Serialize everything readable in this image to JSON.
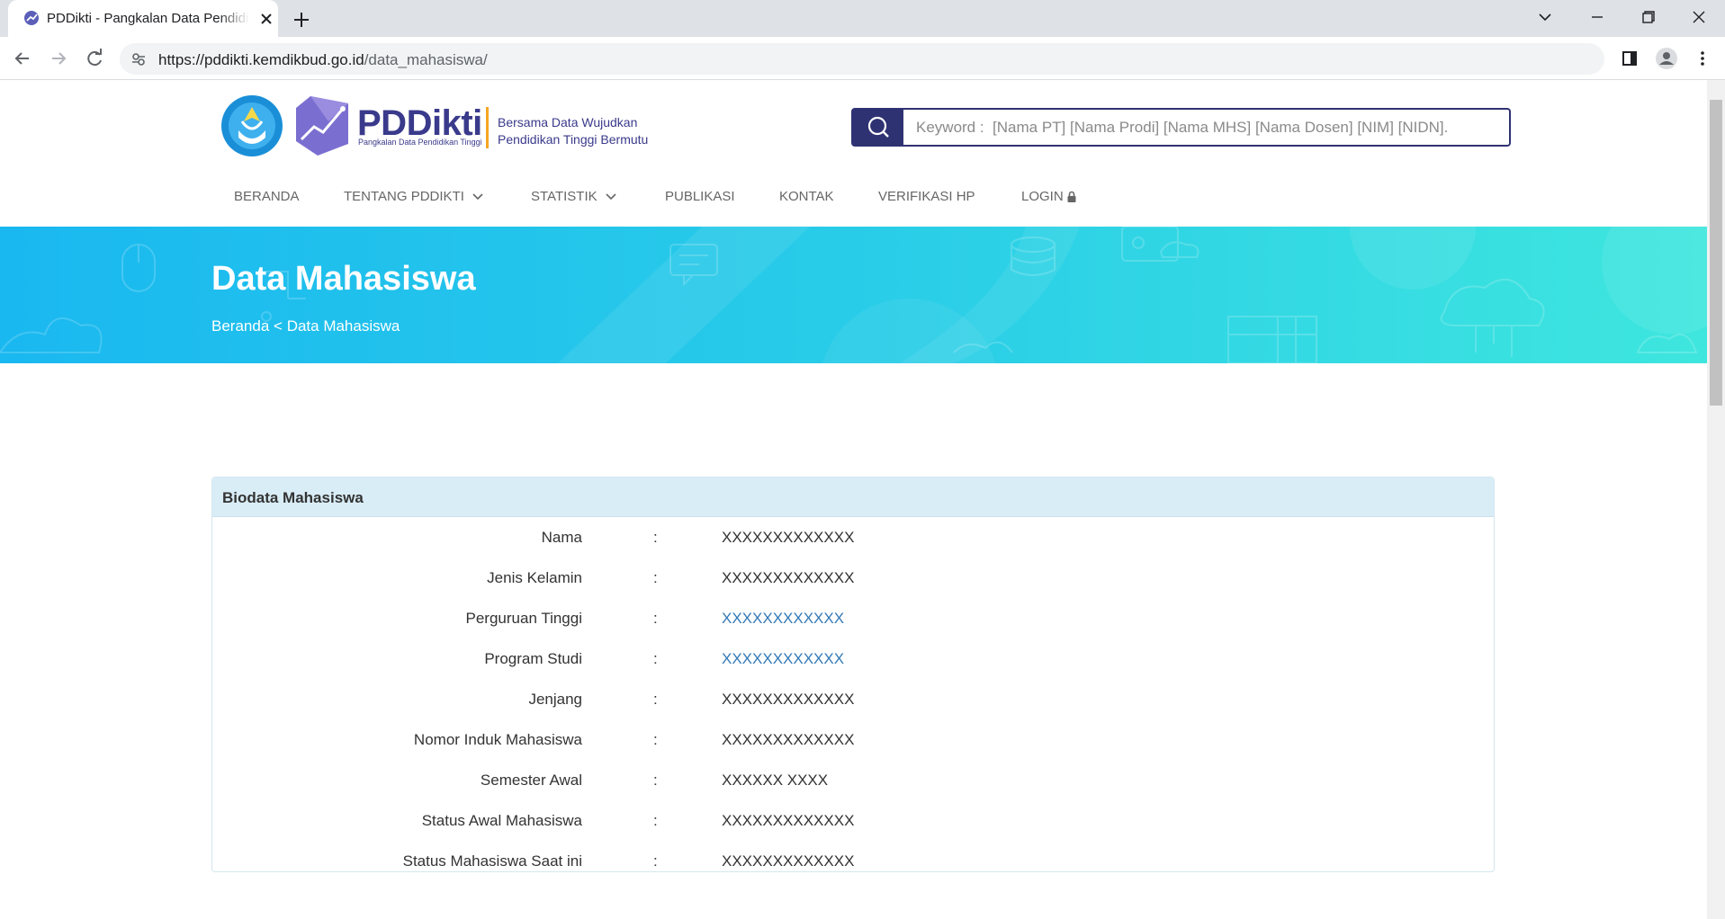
{
  "browser": {
    "tab_title": "PDDikti - Pangkalan Data Pendidikan Tinggi",
    "url_host": "https://pddikti.kemdikbud.go.id",
    "url_path": "/data_mahasiswa/"
  },
  "header": {
    "logo_text": "PDDikti",
    "logo_sub": "Pangkalan Data Pendidikan Tinggi",
    "tagline_line1": "Bersama Data Wujudkan",
    "tagline_line2": "Pendidikan Tinggi Bermutu",
    "search_placeholder": "Keyword :  [Nama PT] [Nama Prodi] [Nama MHS] [Nama Dosen] [NIM] [NIDN]."
  },
  "nav": {
    "items": [
      {
        "label": "BERANDA"
      },
      {
        "label": "TENTANG PDDIKTI"
      },
      {
        "label": "STATISTIK"
      },
      {
        "label": "PUBLIKASI"
      },
      {
        "label": "KONTAK"
      },
      {
        "label": "VERIFIKASI HP"
      },
      {
        "label": "LOGIN"
      }
    ]
  },
  "banner": {
    "title": "Data Mahasiswa",
    "breadcrumb_home": "Beranda",
    "breadcrumb_sep": "<",
    "breadcrumb_current": "Data Mahasiswa"
  },
  "biodata": {
    "title": "Biodata Mahasiswa",
    "separator": ":",
    "rows": [
      {
        "label": "Nama",
        "value": "XXXXXXXXXXXXX"
      },
      {
        "label": "Jenis Kelamin",
        "value": "XXXXXXXXXXXXX"
      },
      {
        "label": "Perguruan Tinggi",
        "value": "XXXXXXXXXXXX"
      },
      {
        "label": "Program Studi",
        "value": "XXXXXXXXXXXX"
      },
      {
        "label": "Jenjang",
        "value": "XXXXXXXXXXXXX"
      },
      {
        "label": "Nomor Induk Mahasiswa",
        "value": "XXXXXXXXXXXXX"
      },
      {
        "label": "Semester Awal",
        "value": "XXXXXX XXXX"
      },
      {
        "label": "Status Awal Mahasiswa",
        "value": "XXXXXXXXXXXXX"
      },
      {
        "label": "Status Mahasiswa Saat ini",
        "value": "XXXXXXXXXXXXX"
      }
    ]
  },
  "colors": {
    "brand_navy": "#2f3272",
    "banner_start": "#1ab8f0",
    "banner_end": "#3ee6de",
    "link": "#337ab7",
    "panel_head": "#d9edf7"
  }
}
